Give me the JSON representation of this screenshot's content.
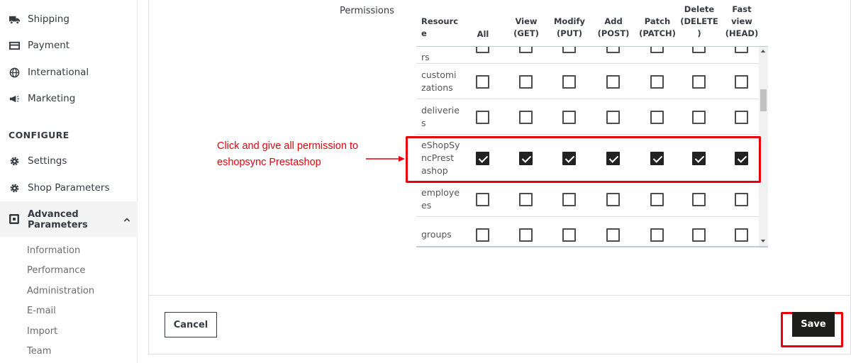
{
  "sidebar": {
    "items": [
      {
        "label": "Shipping",
        "icon": "truck-icon"
      },
      {
        "label": "Payment",
        "icon": "credit-card-icon"
      },
      {
        "label": "International",
        "icon": "globe-icon"
      },
      {
        "label": "Marketing",
        "icon": "megaphone-icon"
      }
    ],
    "configure_title": "CONFIGURE",
    "configure_items": [
      {
        "label": "Settings",
        "icon": "gear-icon"
      },
      {
        "label": "Shop Parameters",
        "icon": "gear-icon"
      }
    ],
    "advanced": {
      "line1": "Advanced",
      "line2": "Parameters",
      "icon": "terminal-icon"
    },
    "sub_items": [
      "Information",
      "Performance",
      "Administration",
      "E-mail",
      "Import",
      "Team"
    ]
  },
  "form": {
    "permissions_label": "Permissions"
  },
  "table": {
    "headers": [
      [
        "Resourc",
        "e"
      ],
      [
        "All"
      ],
      [
        "View",
        "(GET)"
      ],
      [
        "Modify",
        "(PUT)"
      ],
      [
        "Add",
        "(POST)"
      ],
      [
        "Patch",
        "(PATCH)"
      ],
      [
        "Delete",
        "(DELETE",
        ")"
      ],
      [
        "Fast",
        "view",
        "(HEAD)"
      ]
    ],
    "rows": [
      {
        "name": [
          "rs"
        ],
        "checked": [
          false,
          false,
          false,
          false,
          false,
          false,
          false
        ]
      },
      {
        "name": [
          "customi",
          "zations"
        ],
        "checked": [
          false,
          false,
          false,
          false,
          false,
          false,
          false
        ]
      },
      {
        "name": [
          "deliverie",
          "s"
        ],
        "checked": [
          false,
          false,
          false,
          false,
          false,
          false,
          false
        ]
      },
      {
        "name": [
          "eShopSy",
          "ncPrest",
          "ashop"
        ],
        "checked": [
          true,
          true,
          true,
          true,
          true,
          true,
          true
        ]
      },
      {
        "name": [
          "employe",
          "es"
        ],
        "checked": [
          false,
          false,
          false,
          false,
          false,
          false,
          false
        ]
      },
      {
        "name": [
          "groups"
        ],
        "checked": [
          false,
          false,
          false,
          false,
          false,
          false,
          false
        ]
      }
    ]
  },
  "annotation": {
    "line1": "Click and give all permission to",
    "line2": "eshopsync Prestashop",
    "color": "#e8000b"
  },
  "footer": {
    "cancel_label": "Cancel",
    "save_label": "Save"
  }
}
